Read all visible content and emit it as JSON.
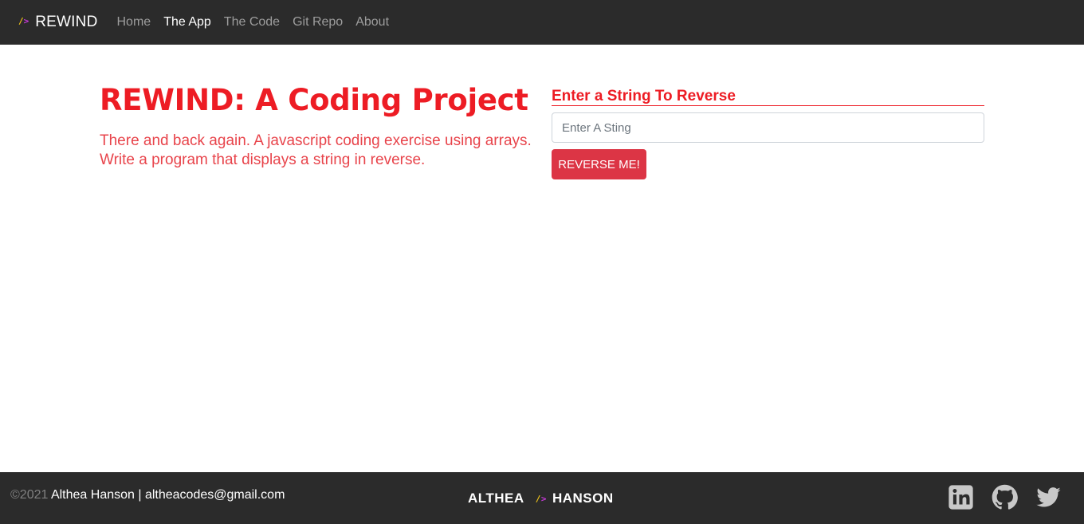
{
  "nav": {
    "brand_slash": "/",
    "brand_gt": ">",
    "brand_name": "REWIND",
    "links": [
      {
        "label": "Home",
        "active": false
      },
      {
        "label": "The App",
        "active": true
      },
      {
        "label": "The Code",
        "active": false
      },
      {
        "label": "Git Repo",
        "active": false
      },
      {
        "label": "About",
        "active": false
      }
    ]
  },
  "hero": {
    "title": "REWIND: A Coding Project",
    "description": "There and back again. A javascript coding exercise using arrays. Write a program that displays a string in reverse."
  },
  "form": {
    "heading": "Enter a String To Reverse",
    "input_value": "",
    "input_placeholder": "Enter A Sting",
    "button_label": "REVERSE ME!"
  },
  "footer": {
    "copyright": "©2021",
    "contact": " Althea Hanson | altheacodes@gmail.com",
    "logo_left": "ALTHEA",
    "logo_slash": "/",
    "logo_gt": ">",
    "logo_right": "HANSON",
    "social_icons": [
      "linkedin-icon",
      "github-icon",
      "twitter-icon"
    ]
  },
  "colors": {
    "accent": "#ed1c24",
    "button": "#dc3545",
    "dark_bg": "#2b2b2b",
    "logo_slash": "#f0c419",
    "logo_gt": "#c63ad8",
    "social_icon": "#c8c8c8"
  }
}
